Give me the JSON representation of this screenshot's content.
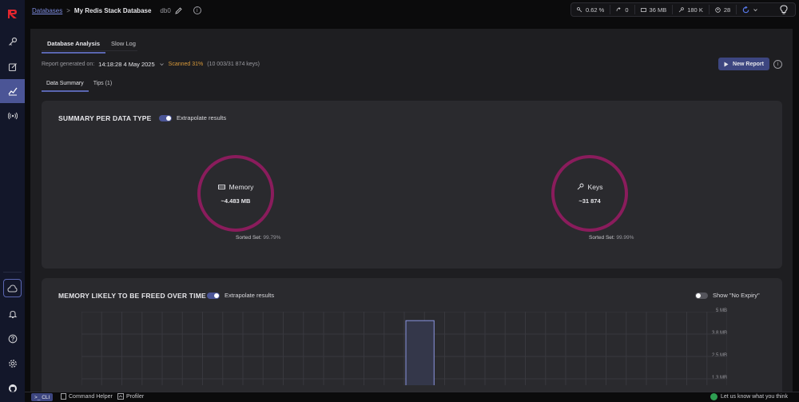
{
  "breadcrumb": {
    "databases_link": "Databases",
    "separator": ">",
    "database_name": "My Redis Stack Database",
    "db_index": "db0"
  },
  "stats": {
    "cpu": "0.62 %",
    "ops": "0",
    "memory": "36 MB",
    "keys": "180 K",
    "clients": "28"
  },
  "tabs": [
    {
      "label": "Database Analysis",
      "active": true
    },
    {
      "label": "Slow Log",
      "active": false
    }
  ],
  "report": {
    "generated_label": "Report generated on:",
    "date": "14:18:28 4 May 2025",
    "scanned": "Scanned 31%",
    "scanned_detail": "(10 003/31 874 keys)",
    "new_report_label": "New Report"
  },
  "subtabs": [
    {
      "label": "Data Summary",
      "active": true
    },
    {
      "label": "Tips (1)",
      "active": false
    }
  ],
  "summary": {
    "title": "SUMMARY PER DATA TYPE",
    "extrapolate_label": "Extrapolate results",
    "memory": {
      "label": "Memory",
      "value": "~4.483 MB",
      "note_type": "Sorted Set:",
      "note_pct": "99.79%"
    },
    "keys": {
      "label": "Keys",
      "value": "~31 874",
      "note_type": "Sorted Set:",
      "note_pct": "99.99%"
    }
  },
  "memory_freed": {
    "title": "MEMORY LIKELY TO BE FREED OVER TIME",
    "extrapolate_label": "Extrapolate results",
    "no_expiry_label": "Show \"No Expiry\"",
    "y_ticks": [
      "5 MB",
      "3.8 MB",
      "2.5 MB",
      "1.3 MB"
    ]
  },
  "chart_data": {
    "type": "bar",
    "title": "MEMORY LIKELY TO BE FREED OVER TIME",
    "ylabel": "",
    "y_ticks": [
      "5 MB",
      "3.8 MB",
      "2.5 MB",
      "1.3 MB"
    ],
    "ylim": [
      0,
      5
    ],
    "unit": "MB",
    "bars": [
      {
        "index": 16,
        "value": 4.5
      }
    ],
    "bar_count": 32
  },
  "bottom": {
    "cli_label": ">_ CLI",
    "command_helper": "Command Helper",
    "profiler": "Profiler",
    "feedback": "Let us know what you think"
  },
  "icons": {
    "logo": "redis-logo",
    "sidebar": [
      "key-icon",
      "edit-icon",
      "analysis-icon",
      "pubsub-icon",
      "cloud-icon",
      "bell-icon",
      "help-icon",
      "settings-icon",
      "github-icon"
    ]
  },
  "colors": {
    "accent": "#4b5596",
    "ring": "#8a1c5c",
    "scanned": "#d99a3a"
  }
}
